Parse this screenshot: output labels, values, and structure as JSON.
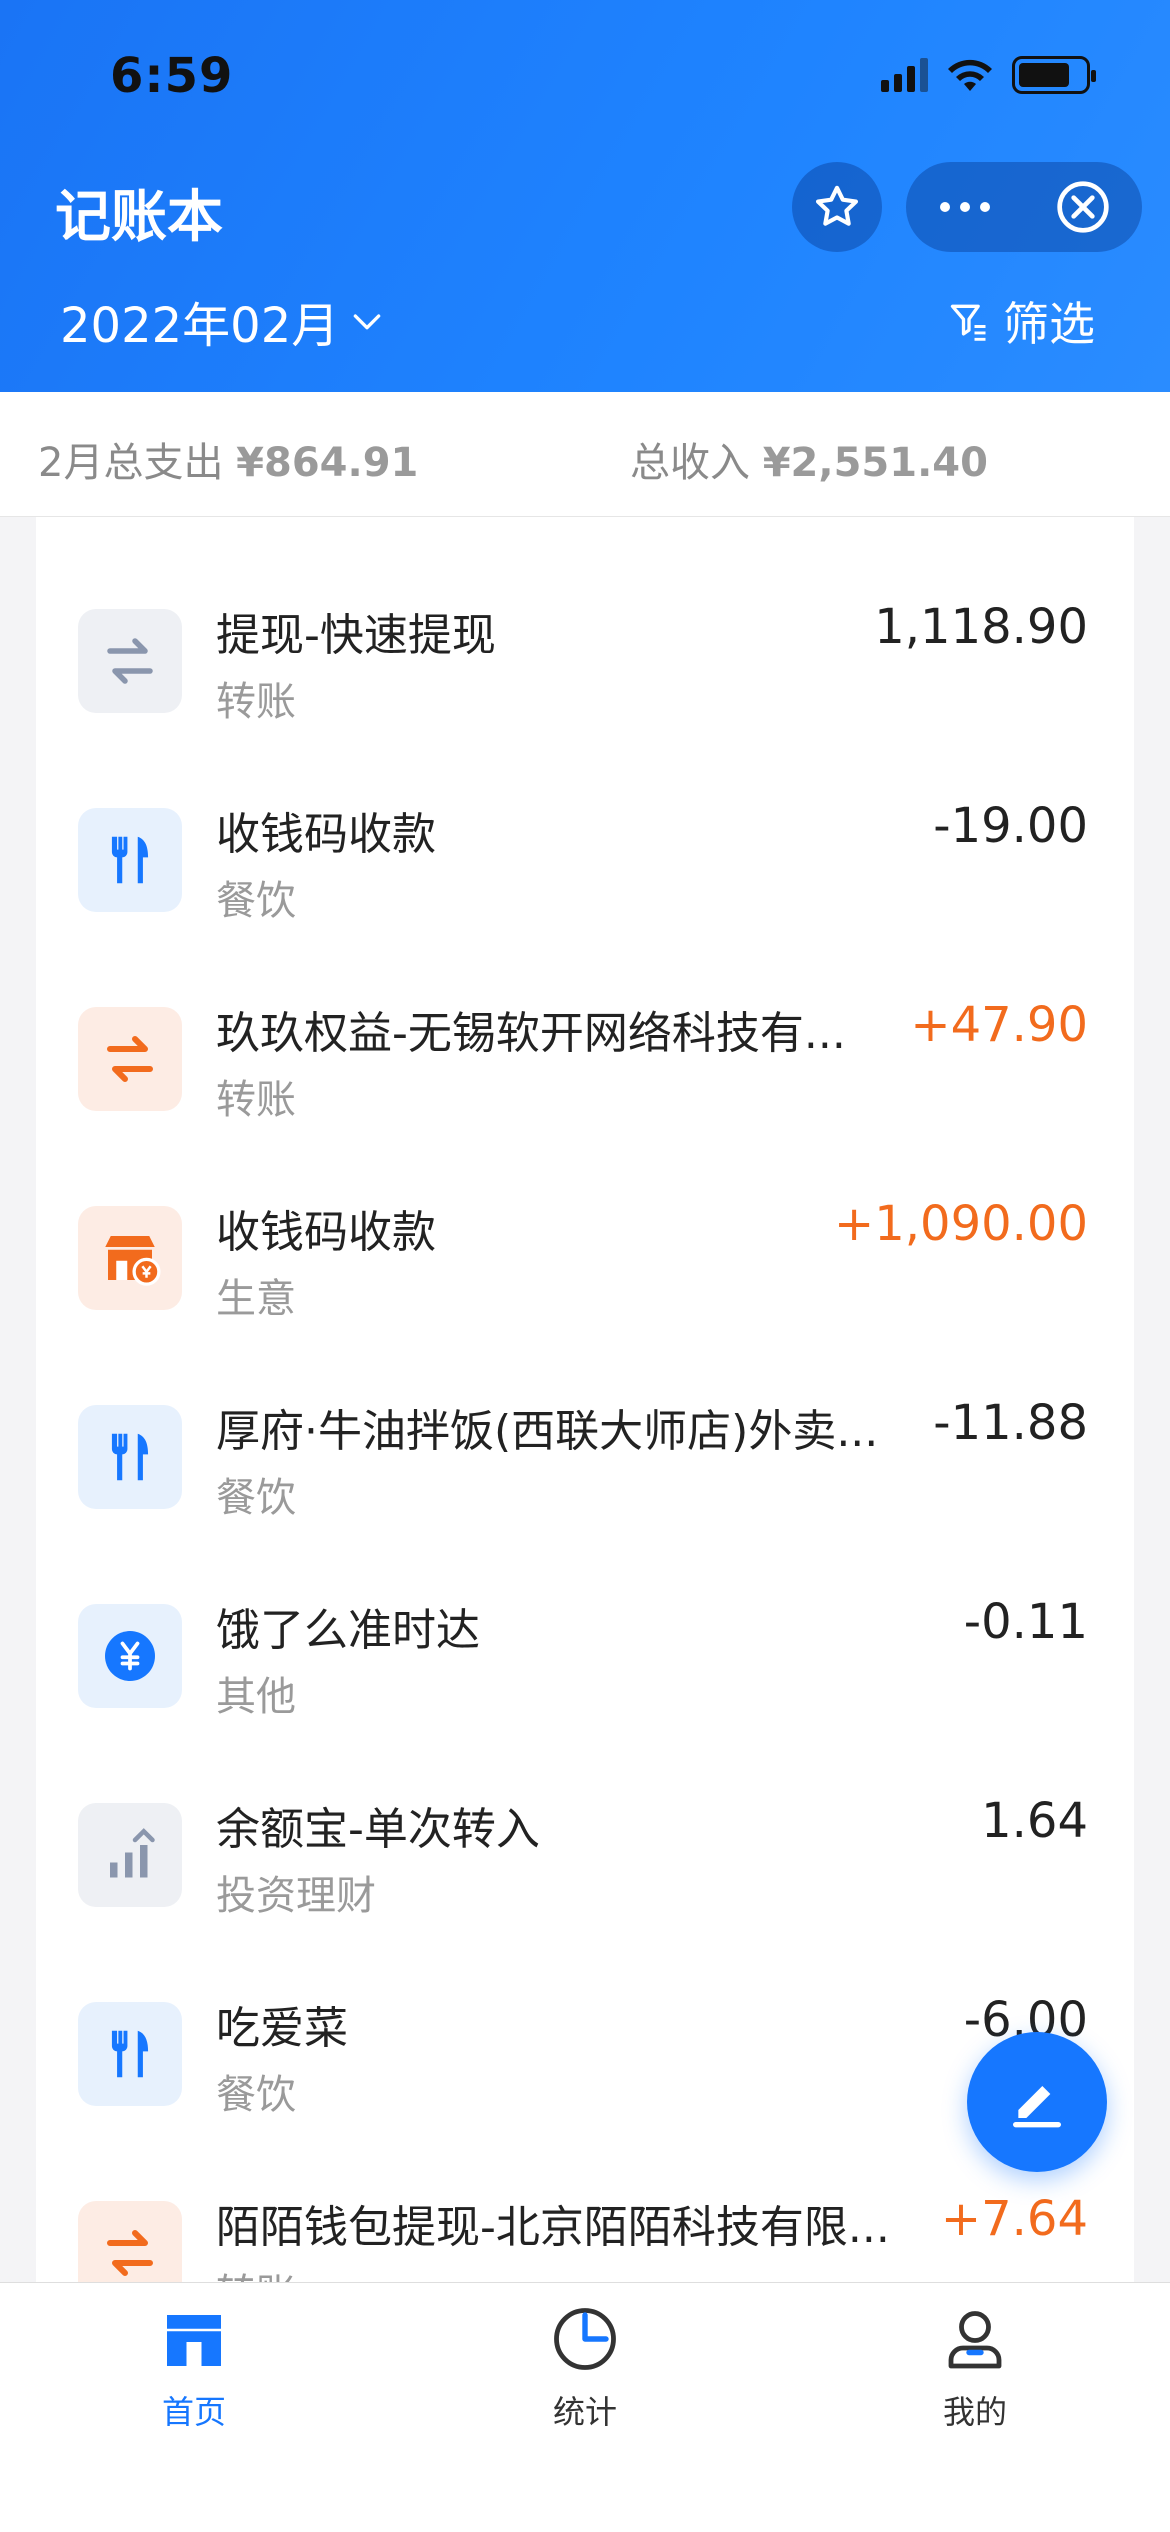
{
  "status_bar": {
    "time": "6:59"
  },
  "header": {
    "title": "记账本",
    "month": "2022年02月",
    "filter_label": "筛选"
  },
  "summary": {
    "expense_label": "2月总支出",
    "expense_value": "¥864.91",
    "income_label": "总收入",
    "income_value": "¥2,551.40"
  },
  "transactions": [
    {
      "title": "提现-快速提现",
      "category": "转账",
      "amount": "1,118.90",
      "type": "neutral",
      "icon": "transfer-icon",
      "icon_color": "#8a96ad"
    },
    {
      "title": "收钱码收款",
      "category": "餐饮",
      "amount": "-19.00",
      "type": "expense",
      "icon": "fork-knife-icon",
      "icon_color": "#1677ff"
    },
    {
      "title": "玖玖权益-无锡软开网络科技有...",
      "category": "转账",
      "amount": "+47.90",
      "type": "income",
      "icon": "transfer-icon",
      "icon_color": "#f26b1d"
    },
    {
      "title": "收钱码收款",
      "category": "生意",
      "amount": "+1,090.00",
      "type": "income",
      "icon": "shop-icon",
      "icon_color": "#f26b1d"
    },
    {
      "title": "厚府·牛油拌饭(西联大师店)外卖...",
      "category": "餐饮",
      "amount": "-11.88",
      "type": "expense",
      "icon": "fork-knife-icon",
      "icon_color": "#1677ff"
    },
    {
      "title": "饿了么准时达",
      "category": "其他",
      "amount": "-0.11",
      "type": "expense",
      "icon": "yuan-coin-icon",
      "icon_color": "#1677ff"
    },
    {
      "title": "余额宝-单次转入",
      "category": "投资理财",
      "amount": "1.64",
      "type": "neutral",
      "icon": "growth-chart-icon",
      "icon_color": "#8a96ad"
    },
    {
      "title": "吃爱菜",
      "category": "餐饮",
      "amount": "-6.00",
      "type": "expense",
      "icon": "fork-knife-icon",
      "icon_color": "#1677ff"
    },
    {
      "title": "陌陌钱包提现-北京陌陌科技有限...",
      "category": "转账",
      "amount": "+7.64",
      "type": "income",
      "icon": "transfer-icon",
      "icon_color": "#f26b1d"
    }
  ],
  "tabs": [
    {
      "label": "首页",
      "icon": "home-icon",
      "active": true
    },
    {
      "label": "统计",
      "icon": "pie-clock-icon",
      "active": false
    },
    {
      "label": "我的",
      "icon": "user-icon",
      "active": false
    }
  ],
  "colors": {
    "brand": "#1677ff",
    "income": "#f26b1d"
  }
}
